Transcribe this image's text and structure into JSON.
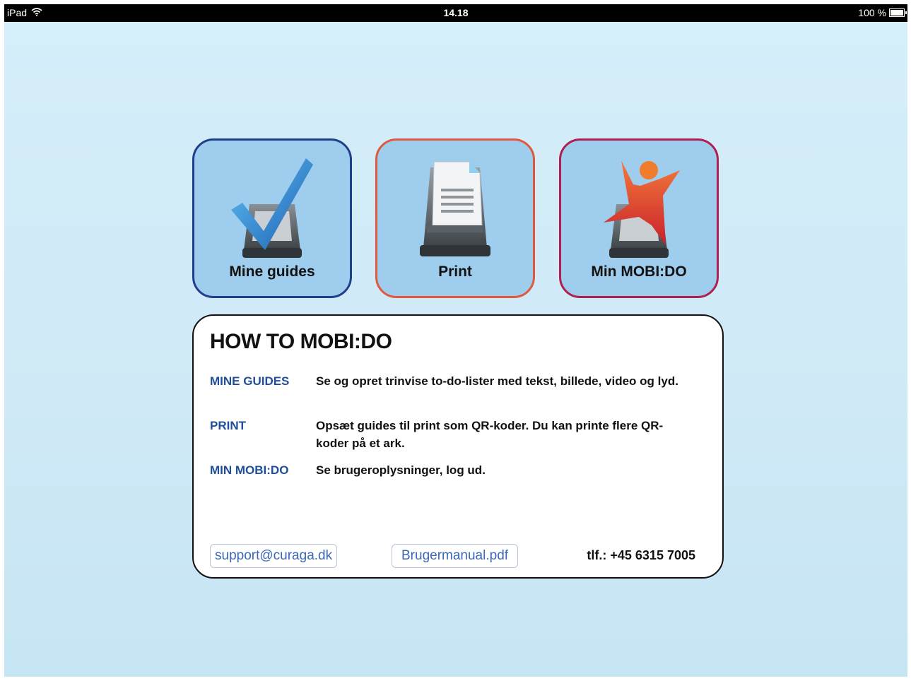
{
  "statusbar": {
    "device": "iPad",
    "time": "14.18",
    "battery": "100 %"
  },
  "tiles": [
    {
      "label": "Mine guides",
      "icon": "checkmark-scanner-icon",
      "border_color": "#1f3f8a"
    },
    {
      "label": "Print",
      "icon": "printer-icon",
      "border_color": "#e0593e"
    },
    {
      "label": "Min MOBI:DO",
      "icon": "person-scanner-icon",
      "border_color": "#b01f52"
    }
  ],
  "info": {
    "title": "HOW TO MOBI:DO",
    "rows": [
      {
        "term": "MINE GUIDES",
        "desc": "Se og opret trinvise to-do-lister med tekst, billede, video og lyd."
      },
      {
        "term": "PRINT",
        "desc": "Opsæt guides til print som QR-koder. Du kan printe flere QR-koder på et ark."
      },
      {
        "term": "MIN MOBI:DO",
        "desc": "Se brugeroplysninger, log ud."
      }
    ],
    "support_link": "support@curaga.dk",
    "manual_link": "Brugermanual.pdf",
    "phone": "tlf.: +45 6315 7005"
  },
  "colors": {
    "accent_blue": "#1f4e9a",
    "link_blue": "#3b67b5",
    "tile_fill": "#9ecdee"
  }
}
